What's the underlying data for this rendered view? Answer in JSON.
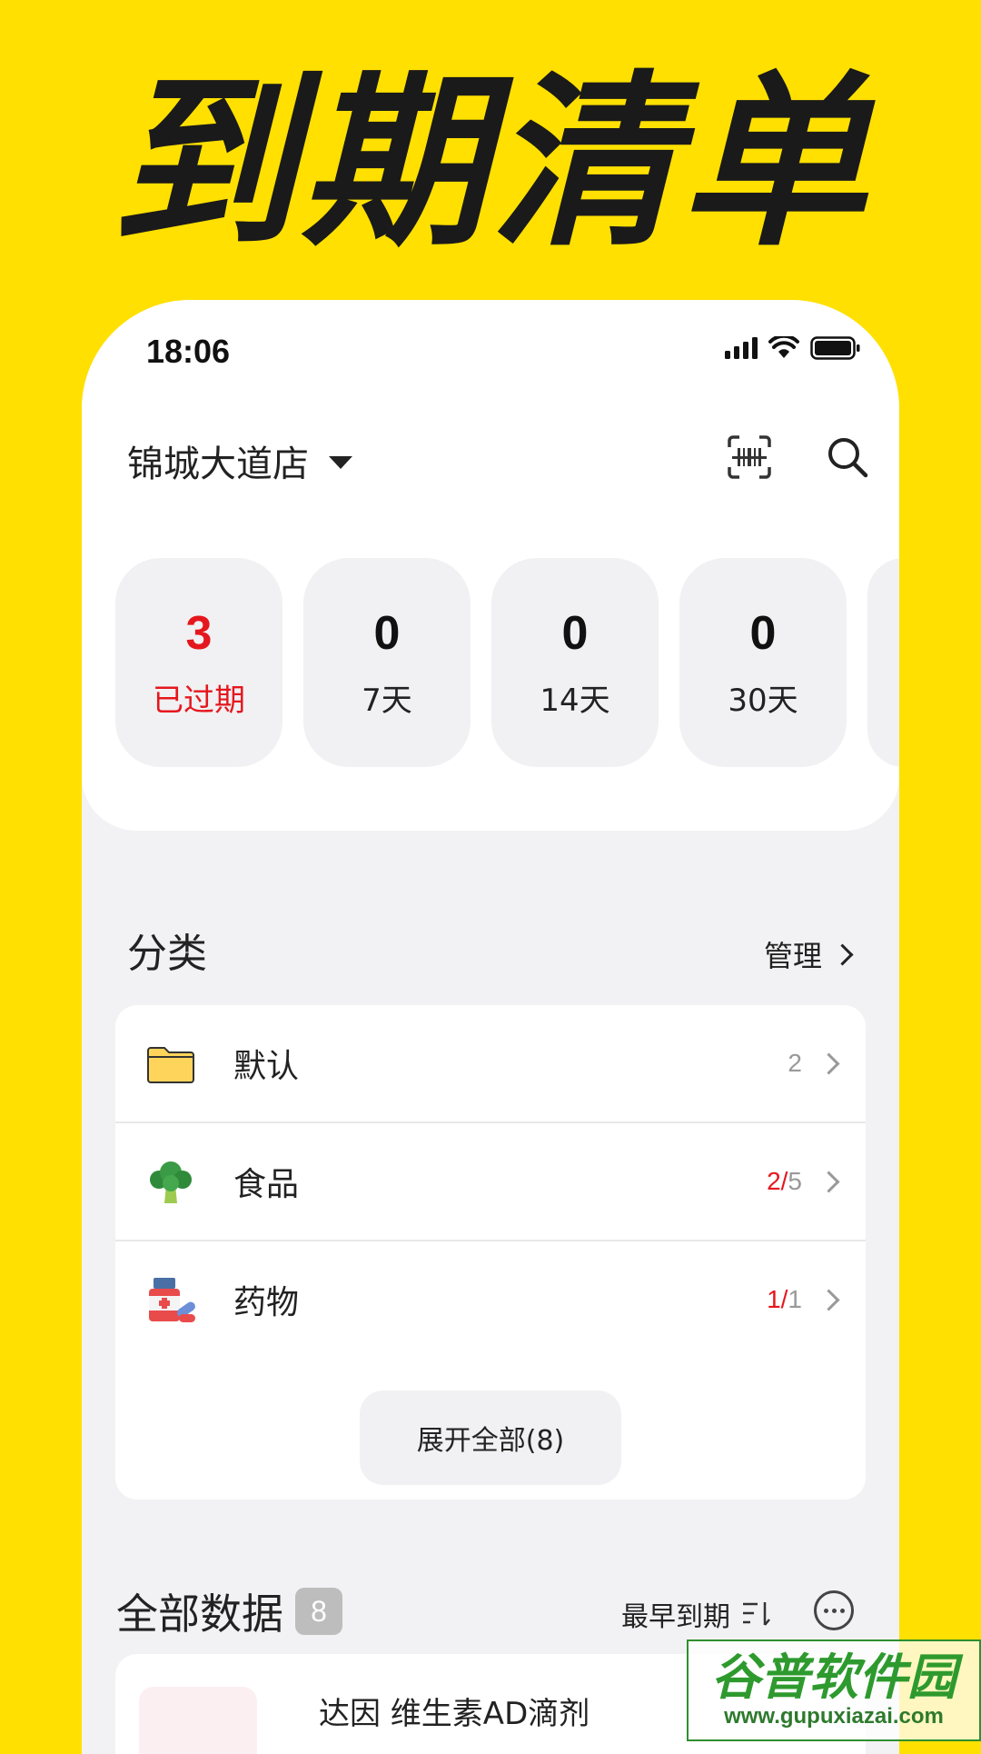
{
  "banner": {
    "title": "到期清单"
  },
  "status_bar": {
    "time": "18:06"
  },
  "header": {
    "store_name": "锦城大道店"
  },
  "stats": [
    {
      "count": "3",
      "label": "已过期"
    },
    {
      "count": "0",
      "label": "7天"
    },
    {
      "count": "0",
      "label": "14天"
    },
    {
      "count": "0",
      "label": "30天"
    }
  ],
  "categories": {
    "title": "分类",
    "manage_label": "管理",
    "items": [
      {
        "name": "默认",
        "expired": "",
        "total": "2"
      },
      {
        "name": "食品",
        "expired": "2/",
        "total": "5"
      },
      {
        "name": "药物",
        "expired": "1/",
        "total": "1"
      }
    ],
    "expand_label": "展开全部(8)"
  },
  "all_data": {
    "title": "全部数据",
    "badge": "8",
    "sort_label": "最早到期",
    "items": [
      {
        "name": "达因 维生素AD滴剂"
      }
    ]
  },
  "watermark": {
    "line1": "谷普软件园",
    "line2": "www.gupuxiazai.com"
  },
  "colors": {
    "background": "#FFE000",
    "expired_red": "#E5171E"
  }
}
